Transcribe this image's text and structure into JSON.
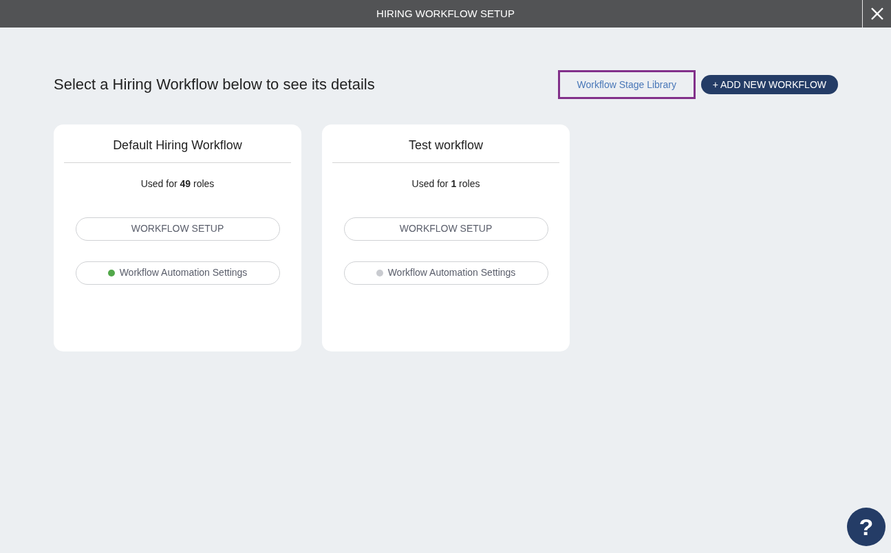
{
  "window": {
    "title": "HIRING WORKFLOW SETUP"
  },
  "heading": "Select a Hiring Workflow below to see its details",
  "stage_library_link": {
    "label": "Workflow Stage Library",
    "focused": true
  },
  "add_button": {
    "label": "+ ADD NEW WORKFLOW"
  },
  "workflows": [
    {
      "title": "Default Hiring Workflow",
      "usage": "Used for **49** roles",
      "setup_button": "WORKFLOW SETUP",
      "automation": {
        "label": "Workflow Automation Settings",
        "color": "#52a84a"
      }
    },
    {
      "title": "Test workflow",
      "usage": "Used for **1** roles",
      "setup_button": "WORKFLOW SETUP",
      "automation": {
        "label": "Workflow Automation Settings",
        "color": "#c9cbd0"
      }
    }
  ],
  "help_button": {
    "label": "?"
  }
}
